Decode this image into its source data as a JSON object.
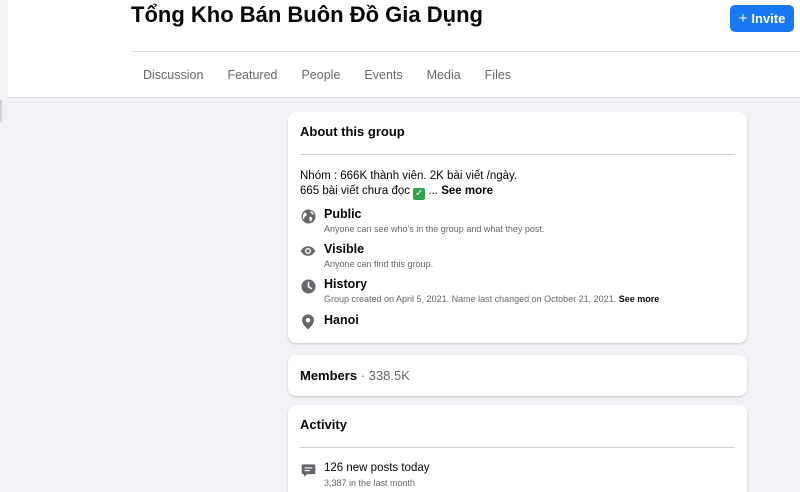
{
  "group": {
    "title": "Tổng Kho Bán Buôn Đồ Gia Dụng",
    "invite_label": "Invite"
  },
  "tabs": [
    "Discussion",
    "Featured",
    "People",
    "Events",
    "Media",
    "Files"
  ],
  "about": {
    "title": "About this group",
    "description_line1": "Nhóm : 666K thành viên. 2K bài viết /ngày.",
    "description_line2": "665 bài viết chưa đọc",
    "check_glyph": "✓",
    "description_suffix": "...",
    "see_more": "See more",
    "items": [
      {
        "icon": "globe-icon",
        "label": "Public",
        "sub": "Anyone can see who's in the group and what they post."
      },
      {
        "icon": "eye-icon",
        "label": "Visible",
        "sub": "Anyone can find this group."
      },
      {
        "icon": "clock-icon",
        "label": "History",
        "sub": "Group created on April 5, 2021. Name last changed on October 21, 2021.",
        "see_more": "See more"
      },
      {
        "icon": "location-pin-icon",
        "label": "Hanoi"
      }
    ]
  },
  "members": {
    "label": "Members",
    "separator": " · ",
    "count": "338.5K"
  },
  "activity": {
    "title": "Activity",
    "posts_today": "126 new posts today",
    "posts_month": "3,387 in the last month"
  },
  "colors": {
    "accent": "#1877f2",
    "page_bg": "#f0f2f5",
    "secondary_text": "#65676b",
    "check_green": "#31a24c"
  }
}
